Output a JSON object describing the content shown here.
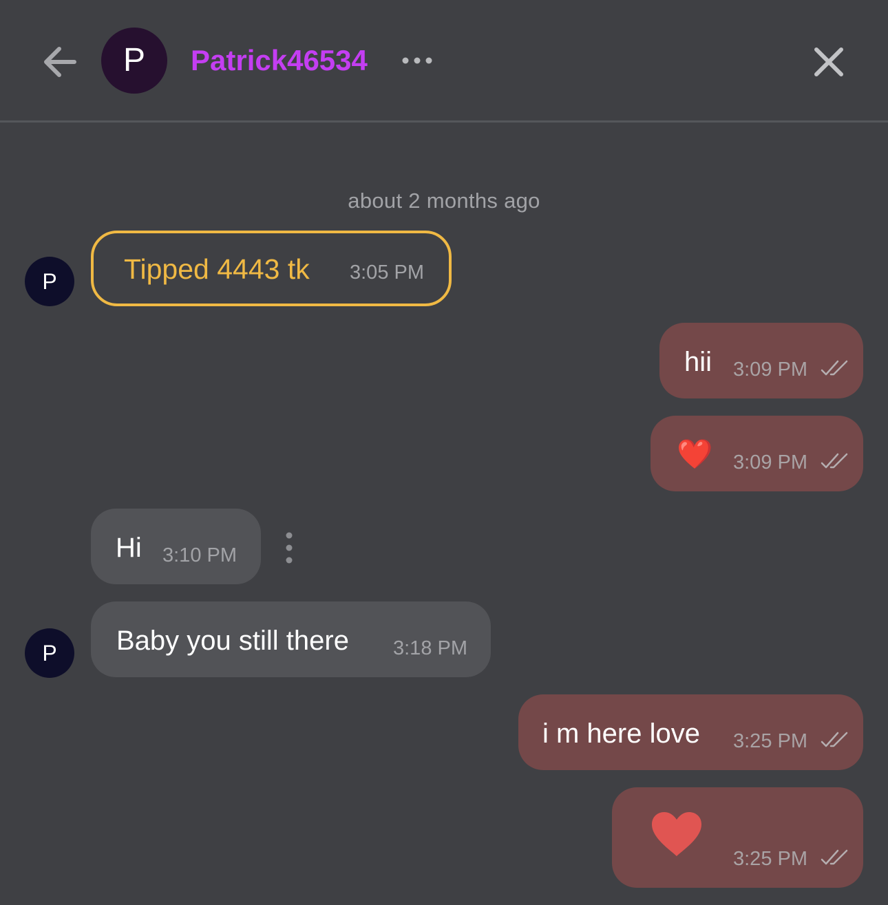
{
  "header": {
    "avatar_letter": "P",
    "username": "Patrick46534",
    "back_icon": "arrow-left-icon",
    "more_icon": "ellipsis-horizontal-icon",
    "close_icon": "close-icon"
  },
  "date_separator": "about 2 months ago",
  "avatar_letter": "P",
  "tip": {
    "text": "Tipped 4443 tk",
    "time": "3:05 PM"
  },
  "messages": [
    {
      "direction": "outgoing",
      "text": "hii",
      "time": "3:09 PM",
      "status": "read"
    },
    {
      "direction": "outgoing",
      "text": "❤️",
      "time": "3:09 PM",
      "status": "read"
    },
    {
      "direction": "incoming",
      "text": "Hi",
      "time": "3:10 PM"
    },
    {
      "direction": "incoming",
      "text": "Baby you still there",
      "time": "3:18 PM"
    },
    {
      "direction": "outgoing",
      "text": "i m here love",
      "time": "3:25 PM",
      "status": "read"
    },
    {
      "direction": "outgoing",
      "text": "heart-icon",
      "time": "3:25 PM",
      "status": "read"
    }
  ],
  "colors": {
    "background": "#3f4044",
    "username": "#c43ef2",
    "tip_accent": "#f0b944",
    "outgoing_bubble": "#744849",
    "incoming_bubble": "#525357",
    "heart": "#e05552"
  }
}
